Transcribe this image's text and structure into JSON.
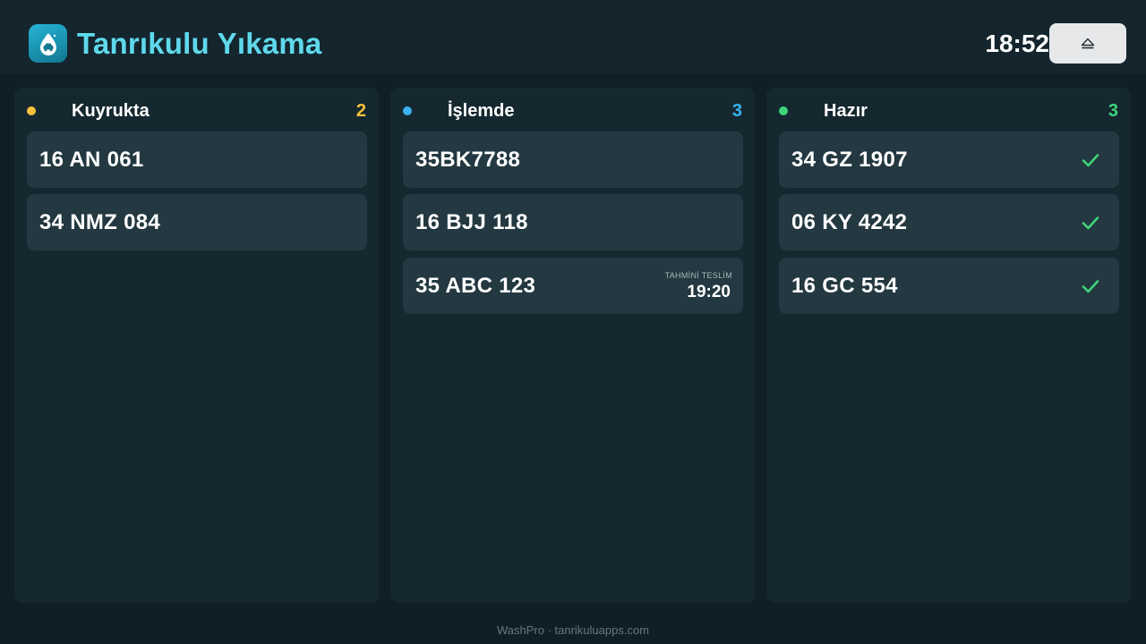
{
  "app": {
    "title": "Tanrıkulu Yıkama",
    "logo_icon": "water-drop-car-icon",
    "clock": "18:52",
    "eject_icon": "eject-icon"
  },
  "colors": {
    "queue": "#f7c13b",
    "processing": "#3ab3f0",
    "ready": "#3fd47b",
    "accent": "#5fd9ec"
  },
  "columns": [
    {
      "title": "Kuyrukta",
      "count": "2",
      "cards": [
        {
          "plate": "16 AN 061"
        },
        {
          "plate": "34 NMZ 084"
        }
      ]
    },
    {
      "title": "İşlemde",
      "count": "3",
      "cards": [
        {
          "plate": "35BK7788"
        },
        {
          "plate": "16 BJJ 118"
        },
        {
          "plate": "35 ABC 123",
          "eta_label": "TAHMİNİ TESLİM",
          "eta_time": "19:20"
        }
      ]
    },
    {
      "title": "Hazır",
      "count": "3",
      "cards": [
        {
          "plate": "34 GZ 1907",
          "status_icon": "check-icon"
        },
        {
          "plate": "06 KY 4242",
          "status_icon": "check-icon"
        },
        {
          "plate": "16 GC 554",
          "status_icon": "check-icon"
        }
      ]
    }
  ],
  "footer": "WashPro · tanrikuluapps.com"
}
